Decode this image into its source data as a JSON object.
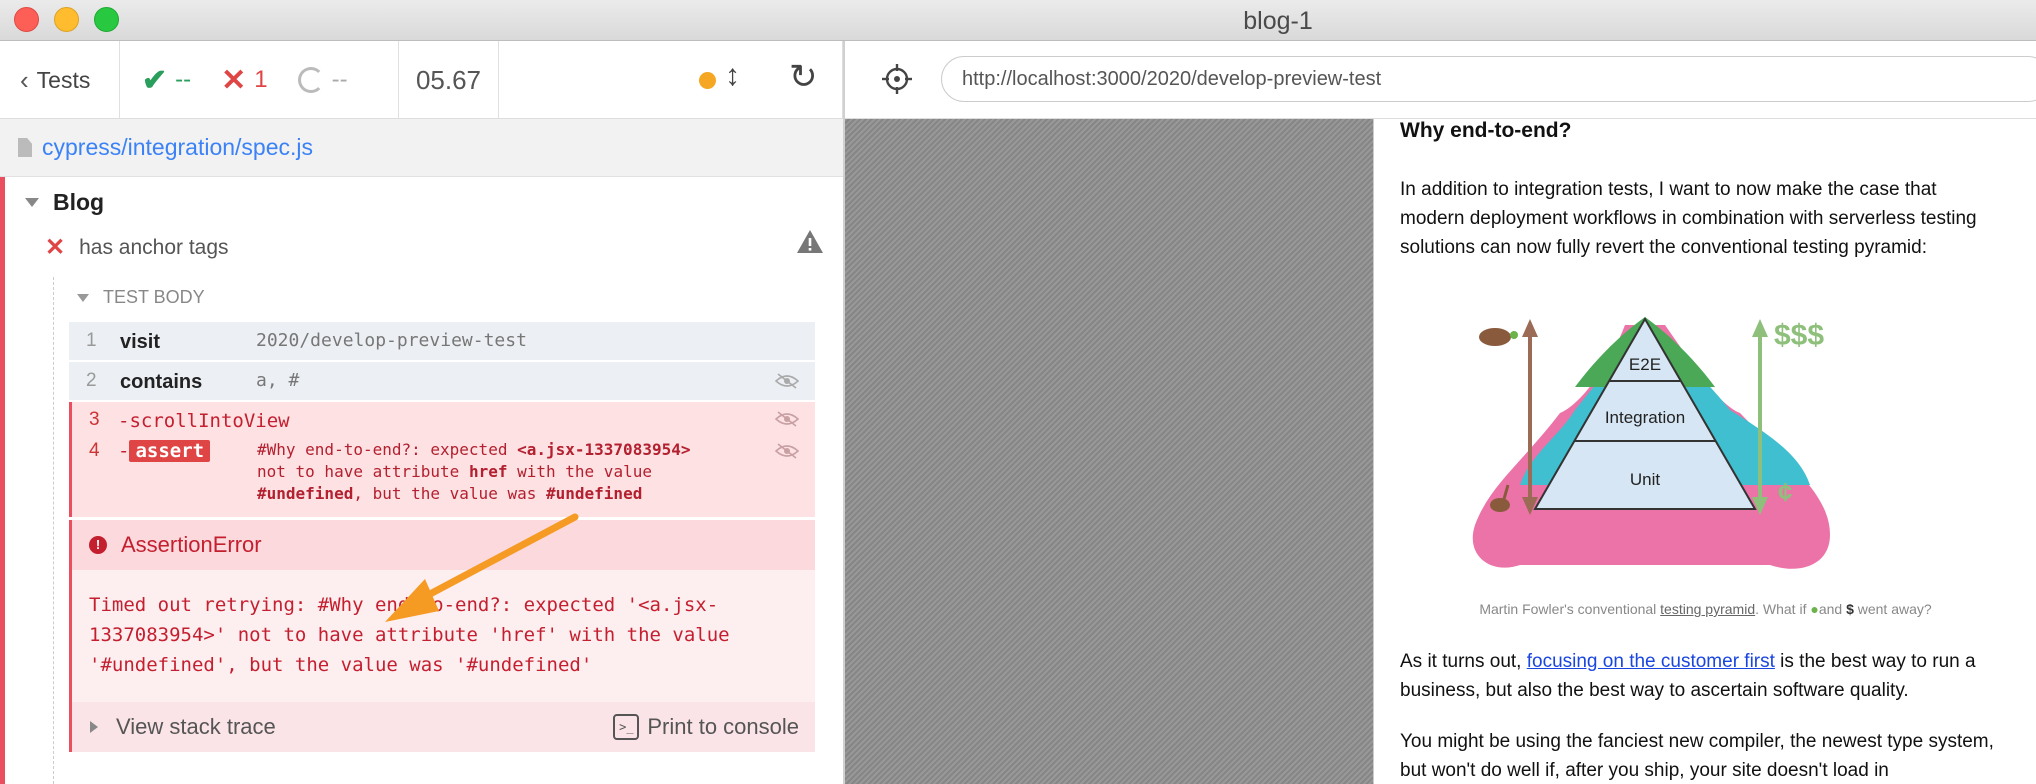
{
  "window": {
    "title": "blog-1"
  },
  "reporter": {
    "back_label": "Tests",
    "passed": "--",
    "failed": "1",
    "pending": "--",
    "duration": "05.67",
    "spec_path": "cypress/integration/spec.js",
    "suite": "Blog",
    "test_title": "has anchor tags",
    "test_body_label": "TEST BODY",
    "commands": [
      {
        "num": "1",
        "name": "visit",
        "message": "2020/develop-preview-test"
      },
      {
        "num": "2",
        "name": "contains",
        "message": "a, #"
      },
      {
        "num": "3",
        "name": "-scrollIntoView",
        "message": ""
      },
      {
        "num": "4",
        "name": "-",
        "badge": "assert",
        "msg_1": "#Why end-to-end?: expected",
        "msg_2": "<a.jsx-1337083954>",
        "msg_3": "not to have attribute",
        "msg_4": "href",
        "msg_5": "with the value",
        "msg_6": "#undefined",
        "msg_7": ", but the value was",
        "msg_8": "#undefined"
      }
    ],
    "error": {
      "type": "AssertionError",
      "message_line1": "Timed out retrying: #Why end-to-end?: expected '<a.jsx-",
      "message_line2": "1337083954>' not to have attribute 'href' with the value",
      "message_line3": "'#undefined', but the value was '#undefined'",
      "stack_label": "View stack trace",
      "console_label": "Print to console"
    }
  },
  "aut": {
    "url": "http://localhost:3000/2020/develop-preview-test",
    "heading": "Why end-to-end?",
    "para1": "In addition to integration tests, I want to now make the case that modern deployment workflows in combination with serverless testing solutions can now fully revert the conventional testing pyramid:",
    "pyramid": {
      "top": "E2E",
      "middle": "Integration",
      "bottom": "Unit",
      "money": "$$$",
      "cents": "¢"
    },
    "caption_a": "Martin Fowler's conventional ",
    "caption_link": "testing pyramid",
    "caption_b": ". What if ",
    "caption_c": "and ",
    "caption_d": " went away?",
    "para2_a": "As it turns out, ",
    "para2_link": "focusing on the customer first",
    "para2_b": " is the best way to run a business, but also the best way to ascertain software quality.",
    "para3": "You might be using the fanciest new compiler, the newest type system, but won't do well if, after you ship, your site doesn't load in"
  },
  "colors": {
    "fail": "#e04545",
    "pass": "#2a9e5c",
    "link": "#3b82f6",
    "running": "#f5a623"
  }
}
